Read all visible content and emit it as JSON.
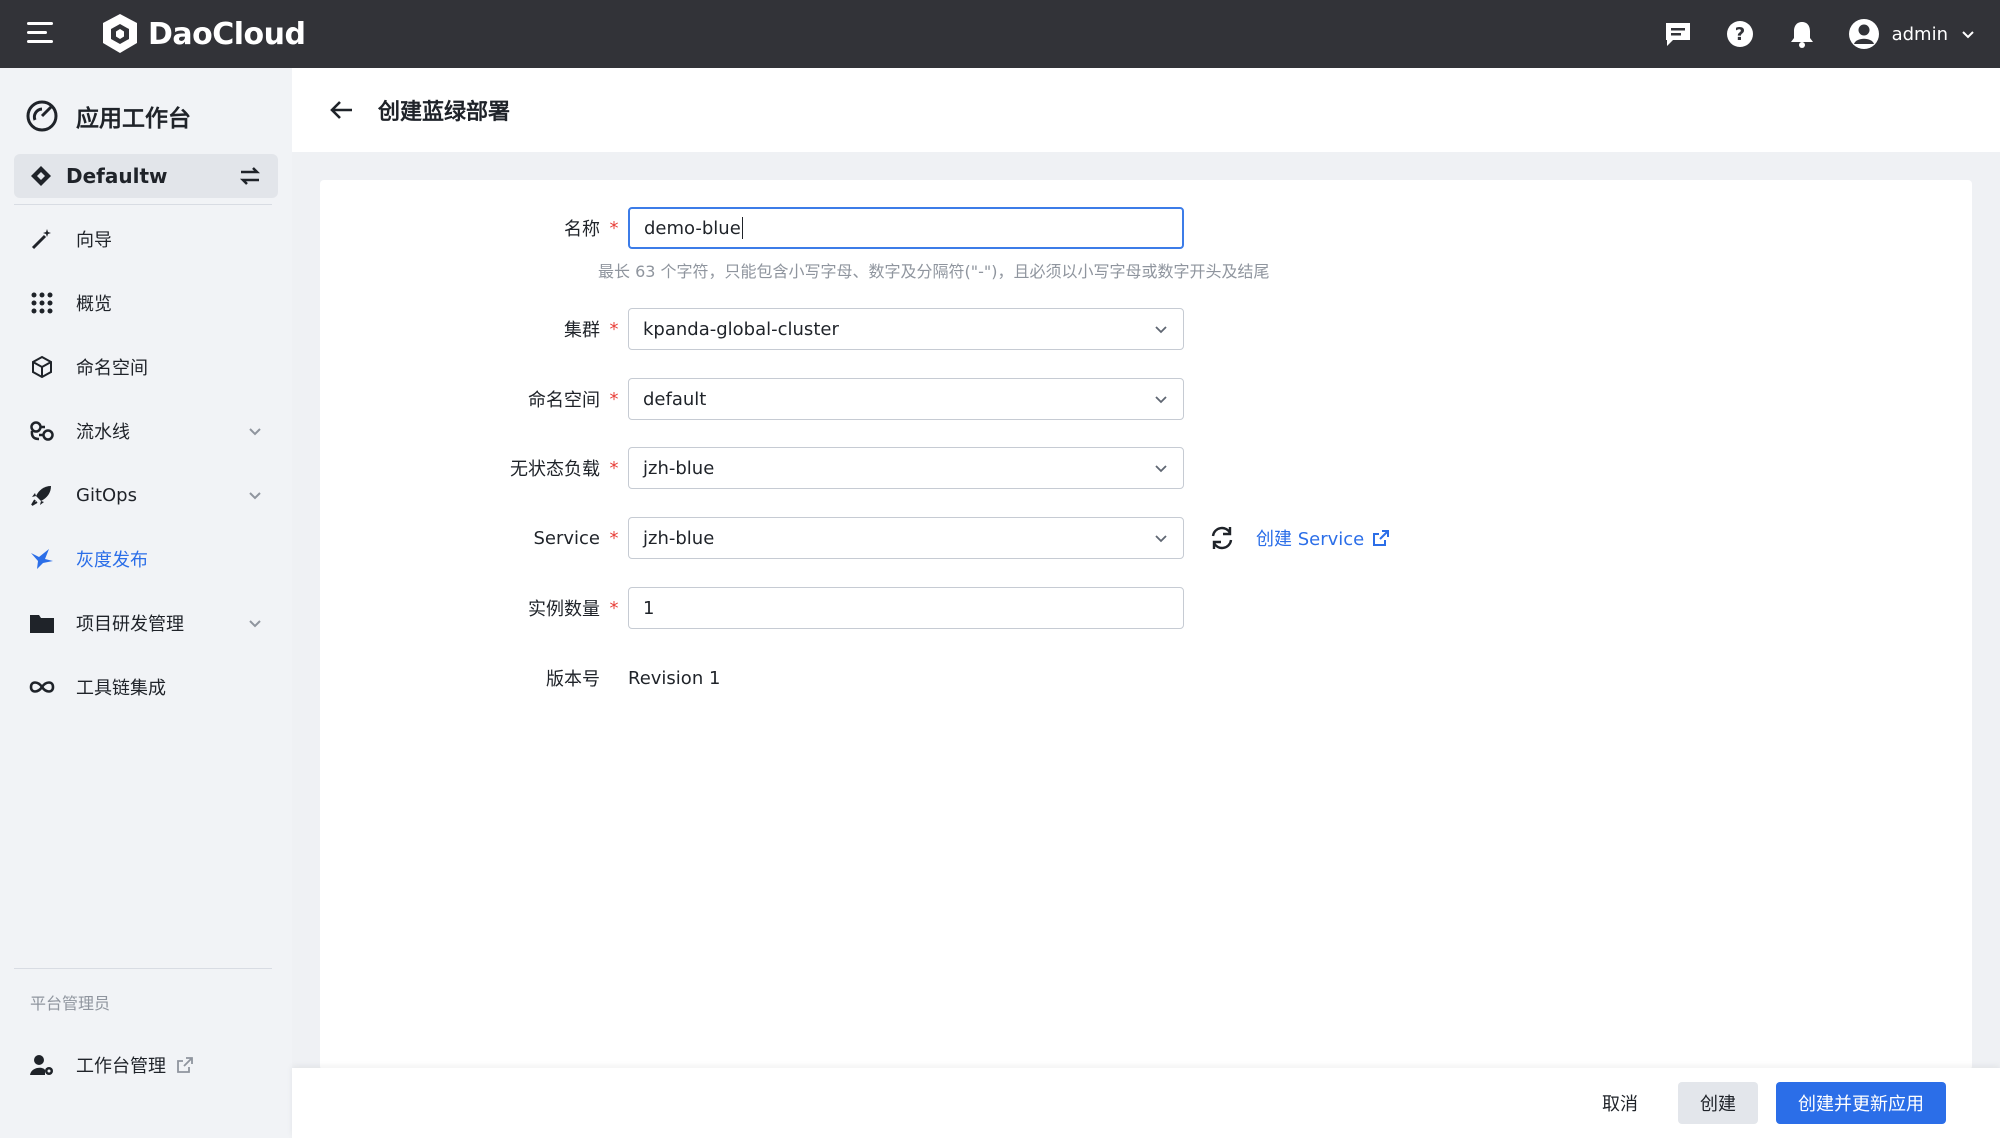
{
  "topbar": {
    "brand": "DaoCloud",
    "user_name": "admin"
  },
  "sidebar": {
    "title": "应用工作台",
    "workspace": "Defaultw",
    "items": [
      {
        "label": "向导"
      },
      {
        "label": "概览"
      },
      {
        "label": "命名空间"
      },
      {
        "label": "流水线"
      },
      {
        "label": "GitOps"
      },
      {
        "label": "灰度发布",
        "active": true
      },
      {
        "label": "项目研发管理"
      },
      {
        "label": "工具链集成"
      }
    ],
    "section_label": "平台管理员",
    "admin_item": "工作台管理"
  },
  "header": {
    "title": "创建蓝绿部署"
  },
  "form": {
    "name": {
      "label": "名称",
      "value": "demo-blue",
      "hint": "最长 63 个字符，只能包含小写字母、数字及分隔符(\"-\")，且必须以小写字母或数字开头及结尾"
    },
    "cluster": {
      "label": "集群",
      "value": "kpanda-global-cluster"
    },
    "namespace": {
      "label": "命名空间",
      "value": "default"
    },
    "workload": {
      "label": "无状态负载",
      "value": "jzh-blue"
    },
    "service": {
      "label": "Service",
      "value": "jzh-blue",
      "create_link": "创建 Service"
    },
    "replicas": {
      "label": "实例数量",
      "value": "1"
    },
    "revision": {
      "label": "版本号",
      "value": "Revision 1"
    }
  },
  "footer": {
    "cancel": "取消",
    "create": "创建",
    "create_update": "创建并更新应用"
  },
  "colors": {
    "accent": "#2b6ee8",
    "topbar": "#323338",
    "required": "#e8413a"
  }
}
